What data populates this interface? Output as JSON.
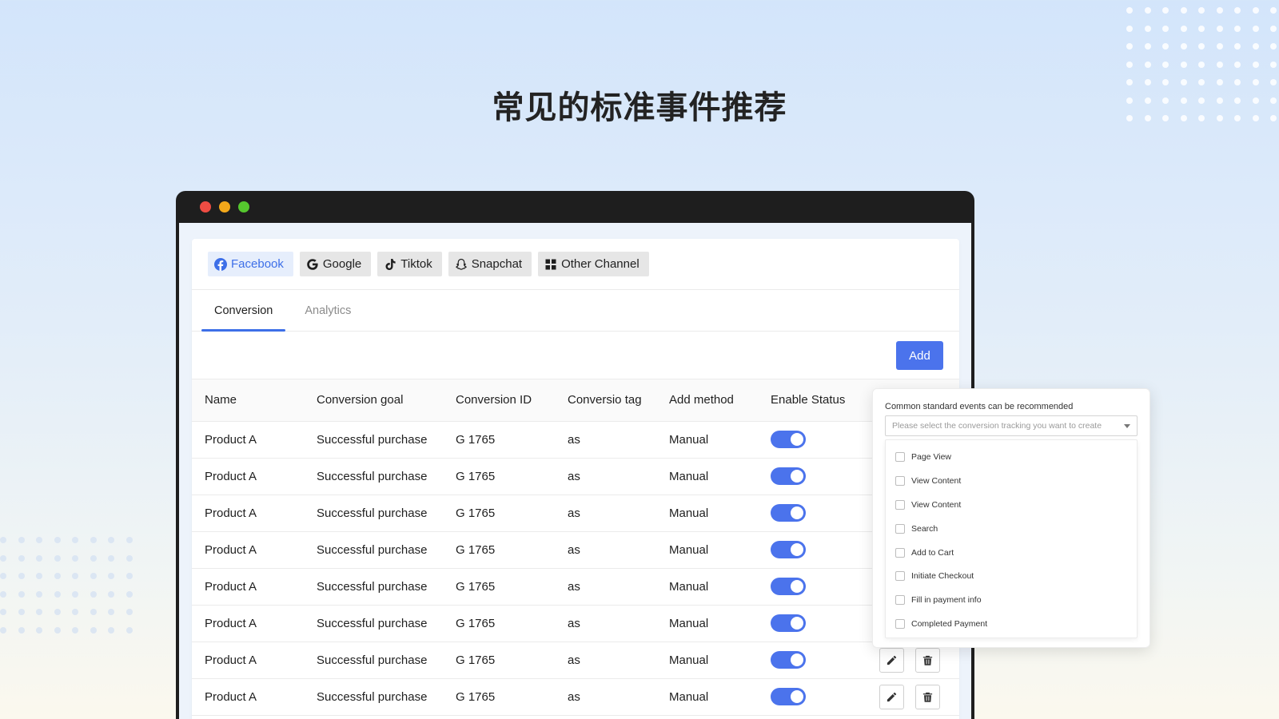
{
  "headline": "常见的标准事件推荐",
  "channels": [
    {
      "label": "Facebook",
      "icon": "facebook-icon"
    },
    {
      "label": "Google",
      "icon": "google-icon"
    },
    {
      "label": "Tiktok",
      "icon": "tiktok-icon"
    },
    {
      "label": "Snapchat",
      "icon": "snapchat-icon"
    },
    {
      "label": "Other Channel",
      "icon": "grid-icon"
    }
  ],
  "tabs": [
    {
      "label": "Conversion"
    },
    {
      "label": "Analytics"
    }
  ],
  "toolbar": {
    "add_label": "Add"
  },
  "table": {
    "columns": [
      "Name",
      "Conversion goal",
      "Conversion ID",
      "Conversio tag",
      "Add method",
      "Enable Status"
    ],
    "rows": [
      {
        "name": "Product A",
        "goal": "Successful purchase",
        "id": "G 1765",
        "tag": "as",
        "method": "Manual",
        "enabled": true
      },
      {
        "name": "Product A",
        "goal": "Successful purchase",
        "id": "G 1765",
        "tag": "as",
        "method": "Manual",
        "enabled": true
      },
      {
        "name": "Product A",
        "goal": "Successful purchase",
        "id": "G 1765",
        "tag": "as",
        "method": "Manual",
        "enabled": true
      },
      {
        "name": "Product A",
        "goal": "Successful purchase",
        "id": "G 1765",
        "tag": "as",
        "method": "Manual",
        "enabled": true
      },
      {
        "name": "Product A",
        "goal": "Successful purchase",
        "id": "G 1765",
        "tag": "as",
        "method": "Manual",
        "enabled": true
      },
      {
        "name": "Product A",
        "goal": "Successful purchase",
        "id": "G 1765",
        "tag": "as",
        "method": "Manual",
        "enabled": true
      },
      {
        "name": "Product A",
        "goal": "Successful purchase",
        "id": "G 1765",
        "tag": "as",
        "method": "Manual",
        "enabled": true
      },
      {
        "name": "Product A",
        "goal": "Successful purchase",
        "id": "G 1765",
        "tag": "as",
        "method": "Manual",
        "enabled": true
      }
    ]
  },
  "popover": {
    "title": "Common standard events can be recommended",
    "placeholder": "Please select the conversion tracking you want to create",
    "options": [
      "Page View",
      "View Content",
      "View Content",
      "Search",
      "Add to Cart",
      "Initiate Checkout",
      "Fill in payment info",
      "Completed Payment"
    ]
  },
  "colors": {
    "accent": "#4b73ec",
    "active_tab_bg": "#e6eefc",
    "titlebar": "#1e1e1e"
  }
}
